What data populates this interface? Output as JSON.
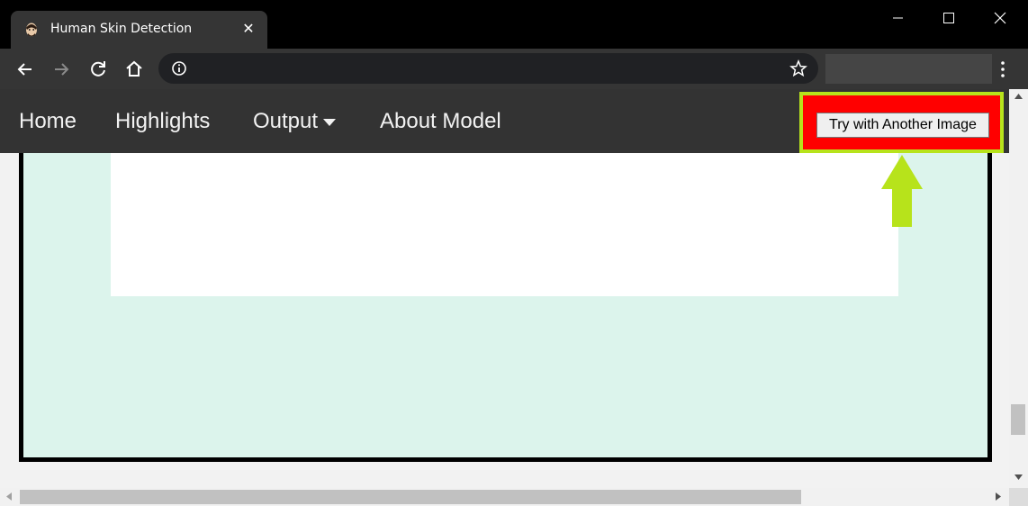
{
  "browser": {
    "tab_title": "Human Skin Detection",
    "tab_close": "✕"
  },
  "navbar": {
    "home": "Home",
    "highlights": "Highlights",
    "output": "Output",
    "about": "About Model"
  },
  "action": {
    "try_button": "Try with Another Image"
  },
  "colors": {
    "highlight_fill": "#ff0000",
    "highlight_border": "#b7e31b",
    "arrow": "#b7e31b",
    "card_bg": "#dcf4ec",
    "navbar_bg": "#333333"
  },
  "icons": [
    "favicon-face-icon",
    "back-icon",
    "forward-icon",
    "reload-icon",
    "home-icon",
    "info-icon",
    "star-icon",
    "menu-icon",
    "minimize-icon",
    "maximize-icon",
    "close-icon",
    "caret-down-icon",
    "up-arrow-icon"
  ]
}
